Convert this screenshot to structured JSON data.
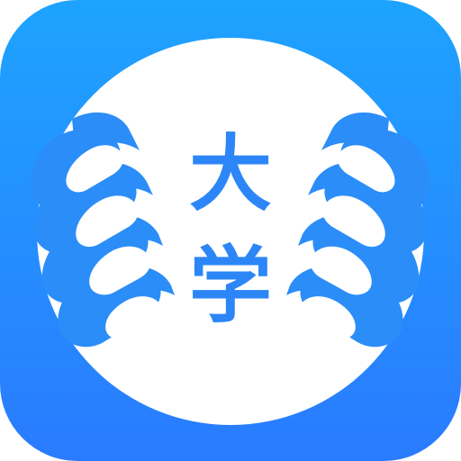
{
  "app_icon": {
    "characters": [
      "大",
      "学"
    ],
    "colors": {
      "background_top": "#1ea3ff",
      "background_bottom": "#2a7bff",
      "circle": "#ffffff",
      "glyph": "#2c86f7"
    },
    "icon_names": {
      "badge": "app-icon",
      "left_hands": "left-hands-icon",
      "right_hands": "right-hands-icon"
    }
  }
}
